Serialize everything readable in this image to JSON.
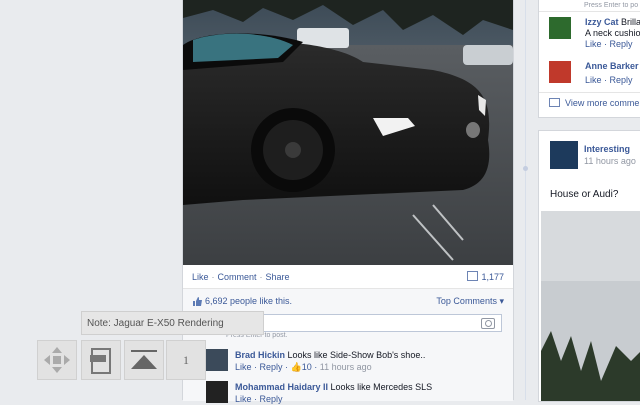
{
  "topright_hint": "Press Enter to po",
  "post": {
    "actions": {
      "like": "Like",
      "comment": "Comment",
      "share": "Share"
    },
    "comment_count": "1,177",
    "likes_text": "6,692 people like this.",
    "top_comments": "Top Comments",
    "comment_placeholder": "t...",
    "press_enter": "Press Enter to post.",
    "comments": [
      {
        "name": "Brad Hickin",
        "text": "Looks like Side-Show Bob's shoe..",
        "like": "Like",
        "reply": "Reply",
        "likes": "10",
        "time": "11 hours ago"
      },
      {
        "name": "Mohammad Haidary II",
        "text": "Looks like Mercedes SLS",
        "like": "Like",
        "reply": "Reply",
        "likes": "",
        "time": ""
      }
    ]
  },
  "right": {
    "comments": [
      {
        "name": "Izzy Cat",
        "name_rest": "Brilla",
        "text": "A neck cushion",
        "like": "Like",
        "reply": "Reply"
      },
      {
        "name": "Anne Barker",
        "text": "",
        "like": "Like",
        "reply": "Reply"
      }
    ],
    "view_more": "View more comme",
    "page_name": "Interesting",
    "page_time": "11 hours ago",
    "post_text": "House or Audi?"
  },
  "viewer": {
    "note": "Note: Jaguar E-X50 Rendering",
    "page_number": "1"
  },
  "colors": {
    "link": "#3b5998",
    "bg": "#e9ebee"
  }
}
